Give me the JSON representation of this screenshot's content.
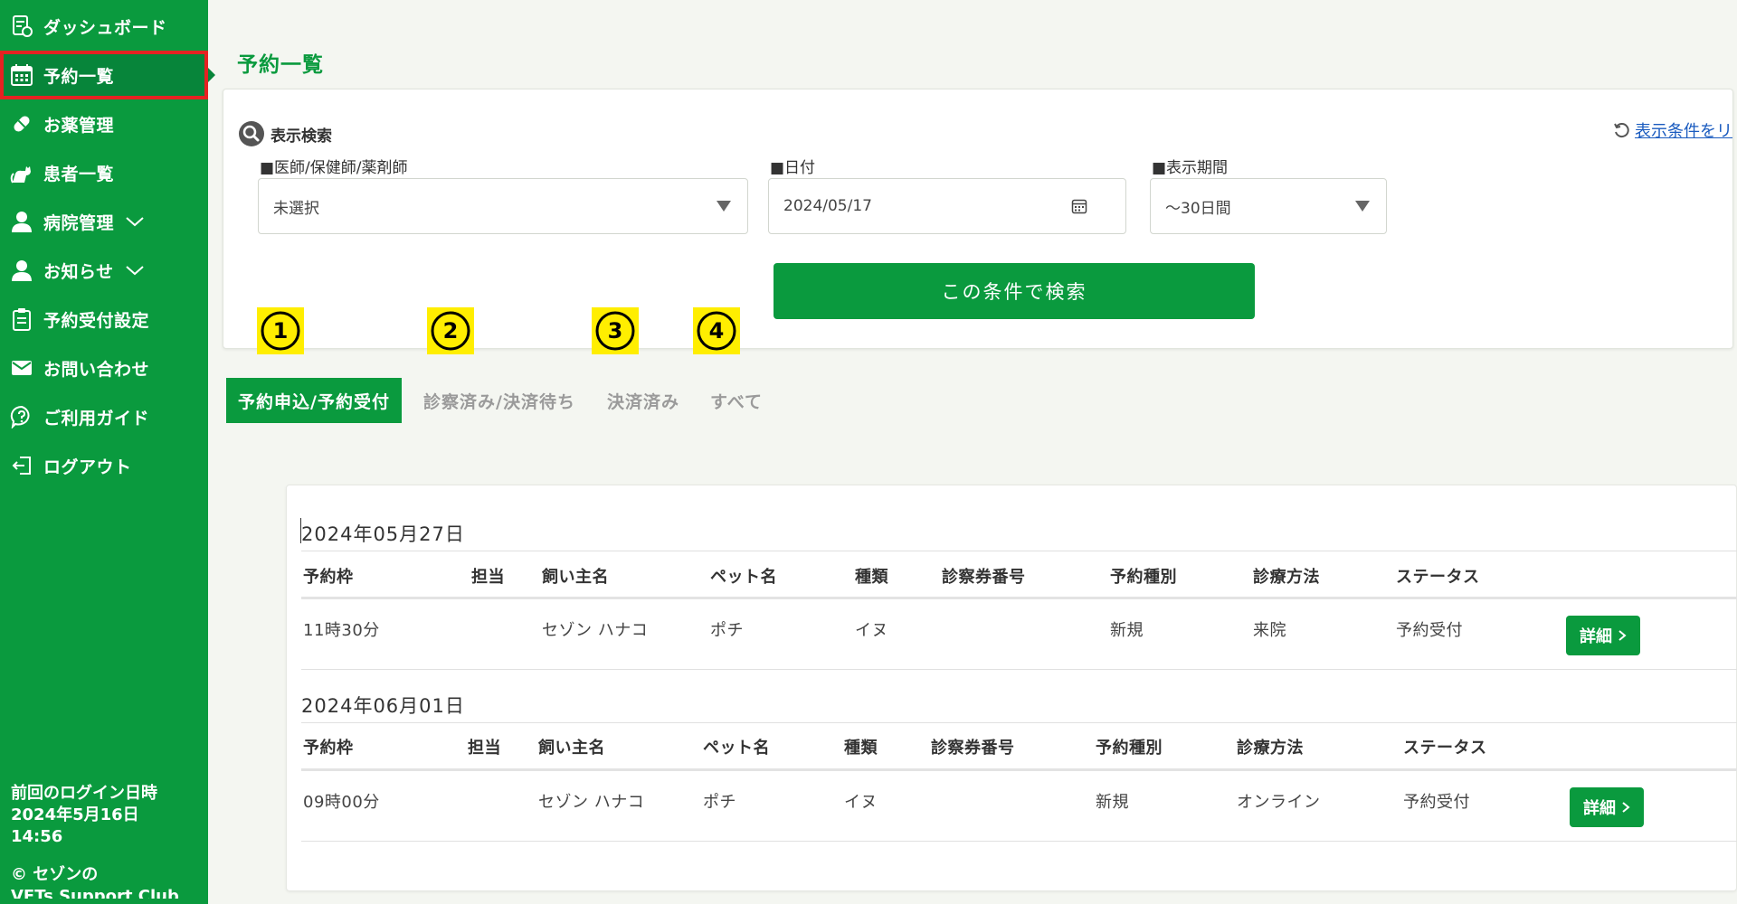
{
  "sidebar": {
    "items": [
      {
        "label": "ダッシュボード",
        "icon": "dashboard-icon"
      },
      {
        "label": "予約一覧",
        "icon": "calendar-icon"
      },
      {
        "label": "お薬管理",
        "icon": "pill-icon"
      },
      {
        "label": "患者一覧",
        "icon": "cat-icon"
      },
      {
        "label": "病院管理",
        "icon": "person-icon"
      },
      {
        "label": "お知らせ",
        "icon": "person-icon"
      },
      {
        "label": "予約受付設定",
        "icon": "clipboard-icon"
      },
      {
        "label": "お問い合わせ",
        "icon": "mail-icon"
      },
      {
        "label": "ご利用ガイド",
        "icon": "help-bubble-icon"
      },
      {
        "label": "ログアウト",
        "icon": "logout-icon"
      }
    ],
    "last_login_label": "前回のログイン日時",
    "last_login_date": "2024年5月16日",
    "last_login_time": "14:56",
    "copyright_line1": "© セゾンの",
    "copyright_line2": "VETs Support Club"
  },
  "page": {
    "title": "予約一覧"
  },
  "search": {
    "heading": "表示検索",
    "reset_label": "表示条件をリ",
    "doctor_label": "■医師/保健師/薬剤師",
    "doctor_value": "未選択",
    "date_label": "■日付",
    "date_value": "2024/05/17",
    "period_label": "■表示期間",
    "period_value": "～30日間",
    "submit_label": "この条件で検索"
  },
  "tabs": [
    {
      "label": "予約申込/予約受付",
      "number": "1",
      "active": true
    },
    {
      "label": "診察済み/決済待ち",
      "number": "2",
      "active": false
    },
    {
      "label": "決済済み",
      "number": "3",
      "active": false
    },
    {
      "label": "すべて",
      "number": "4",
      "active": false
    }
  ],
  "table": {
    "columns": [
      "予約枠",
      "担当",
      "飼い主名",
      "ペット名",
      "種類",
      "診察券番号",
      "予約種別",
      "診療方法",
      "ステータス"
    ],
    "groups": [
      {
        "date": "2024年05月27日",
        "rows": [
          {
            "slot": "11時30分",
            "staff": "",
            "owner": "セゾン ハナコ",
            "pet": "ポチ",
            "species": "イヌ",
            "card_no": "",
            "type": "新規",
            "method": "来院",
            "status": "予約受付",
            "action": "詳細"
          }
        ]
      },
      {
        "date": "2024年06月01日",
        "rows": [
          {
            "slot": "09時00分",
            "staff": "",
            "owner": "セゾン ハナコ",
            "pet": "ポチ",
            "species": "イヌ",
            "card_no": "",
            "type": "新規",
            "method": "オンライン",
            "status": "予約受付",
            "action": "詳細"
          }
        ]
      }
    ]
  },
  "colors": {
    "brand_green": "#0a9a3e",
    "highlight_red": "#e52222",
    "badge_yellow": "#ffee00",
    "link_blue": "#1a5bbf"
  }
}
